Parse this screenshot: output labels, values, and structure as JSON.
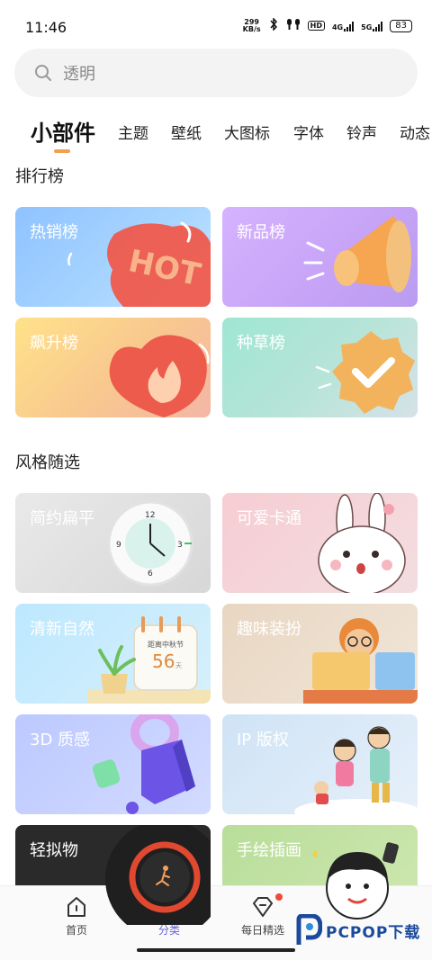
{
  "status": {
    "time": "11:46",
    "speed_value": "299",
    "speed_unit": "KB/s",
    "hd": "HD",
    "net1": "4G",
    "net2": "5G",
    "battery": "83"
  },
  "search": {
    "placeholder": "透明"
  },
  "tabs": [
    {
      "label": "小部件",
      "active": true
    },
    {
      "label": "主题"
    },
    {
      "label": "壁纸"
    },
    {
      "label": "大图标"
    },
    {
      "label": "字体"
    },
    {
      "label": "铃声"
    },
    {
      "label": "动态"
    }
  ],
  "rank": {
    "title": "排行榜",
    "cards": [
      {
        "label": "热销榜",
        "icon": "hot-tag-icon"
      },
      {
        "label": "新品榜",
        "icon": "megaphone-icon"
      },
      {
        "label": "飙升榜",
        "icon": "flame-heart-icon"
      },
      {
        "label": "种草榜",
        "icon": "check-badge-icon"
      }
    ]
  },
  "style": {
    "title": "风格随选",
    "cards": [
      {
        "label": "简约扁平",
        "icon": "clock-icon",
        "clock_digits": [
          "12",
          "3",
          "6",
          "9"
        ]
      },
      {
        "label": "可爱卡通",
        "icon": "bunny-icon"
      },
      {
        "label": "清新自然",
        "icon": "calendar-icon",
        "cal_caption": "距离中秋节",
        "cal_number": "56",
        "cal_unit": "天"
      },
      {
        "label": "趣味装扮",
        "icon": "desk-character-icon"
      },
      {
        "label": "3D 质感",
        "icon": "3d-shapes-icon"
      },
      {
        "label": "IP 版权",
        "icon": "cartoon-characters-icon"
      },
      {
        "label": "轻拟物",
        "icon": "runner-ring-icon"
      },
      {
        "label": "手绘插画",
        "icon": "selfie-illustration-icon"
      }
    ]
  },
  "hot_text": "HOT",
  "nav": [
    {
      "label": "首页",
      "icon": "home-icon"
    },
    {
      "label": "分类",
      "icon": "bookmark-icon",
      "active": true
    },
    {
      "label": "每日精选",
      "icon": "diamond-icon"
    },
    {
      "label": "",
      "icon": "chat-face-icon"
    }
  ],
  "watermark": {
    "text": "PCPOP下载"
  }
}
